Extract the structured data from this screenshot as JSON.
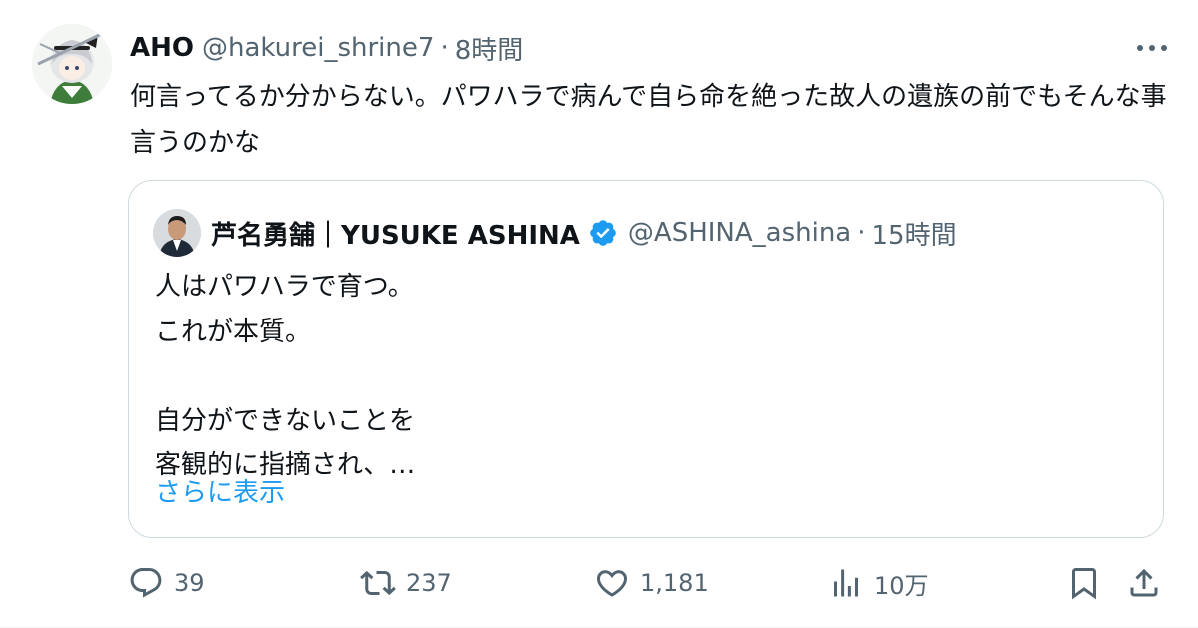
{
  "tweet": {
    "author": {
      "name": "AHO",
      "handle": "@hakurei_shrine7",
      "separator": "·",
      "time": "8時間"
    },
    "text": "何言ってるか分からない。パワハラで病んで自ら命を絶った故人の遺族の前でもそんな事言うのかな",
    "quote": {
      "author": {
        "name": "芦名勇舗｜YUSUKE ASHINA",
        "handle": "@ASHINA_ashina",
        "separator": "·",
        "time": "15時間",
        "verified": true
      },
      "lines": [
        "人はパワハラで育つ。",
        "これが本質。",
        "",
        "自分ができないことを",
        "客観的に指摘され、…"
      ],
      "show_more": "さらに表示"
    },
    "actions": {
      "reply_count": "39",
      "retweet_count": "237",
      "like_count": "1,181",
      "views_count": "10万"
    }
  },
  "colors": {
    "text_primary": "#0f1419",
    "text_secondary": "#536471",
    "link": "#1d9bf0",
    "verified": "#1d9bf0",
    "border": "#cfd9de"
  },
  "icons": {
    "more": "more-icon",
    "verified": "verified-badge-icon",
    "reply": "reply-icon",
    "retweet": "retweet-icon",
    "like": "heart-icon",
    "views": "views-icon",
    "bookmark": "bookmark-icon",
    "share": "share-icon"
  }
}
